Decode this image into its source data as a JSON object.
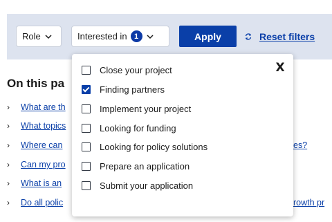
{
  "filters": {
    "role_label": "Role",
    "interested_label": "Interested in",
    "interested_count": "1",
    "apply_label": "Apply",
    "reset_label": "Reset filters"
  },
  "on_this_page": {
    "title": "On this pa",
    "items": [
      {
        "text": "What are th",
        "tail": ""
      },
      {
        "text": "What topics",
        "tail": ""
      },
      {
        "text": "Where can",
        "tail": "es?"
      },
      {
        "text": "Can my pro",
        "tail": ""
      },
      {
        "text": "What is an",
        "tail": ""
      },
      {
        "text": "Do all polic",
        "tail": "rowth pr"
      }
    ]
  },
  "dropdown": {
    "close_label": "X",
    "options": [
      {
        "label": "Close your project",
        "checked": false
      },
      {
        "label": "Finding partners",
        "checked": true
      },
      {
        "label": "Implement your project",
        "checked": false
      },
      {
        "label": "Looking for funding",
        "checked": false
      },
      {
        "label": "Looking for policy solutions",
        "checked": false
      },
      {
        "label": "Prepare an application",
        "checked": false
      },
      {
        "label": "Submit your application",
        "checked": false
      }
    ]
  },
  "colors": {
    "accent": "#0a3fa8",
    "filter_bar_bg": "#dde3ef"
  }
}
